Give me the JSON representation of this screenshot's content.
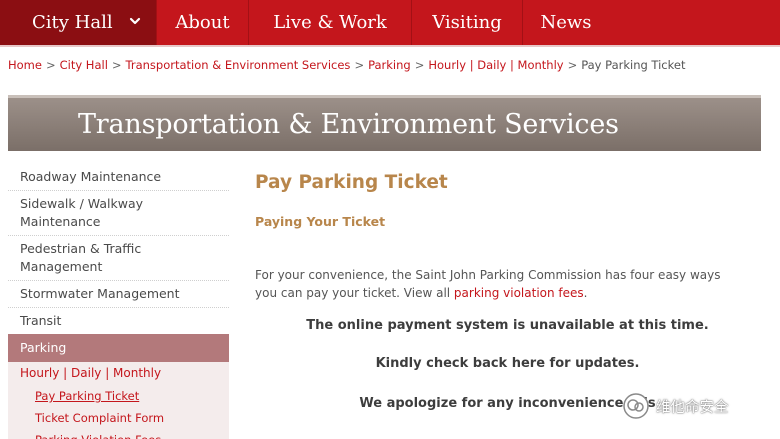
{
  "topnav": {
    "city_hall": "City Hall",
    "about": "About",
    "live_work": "Live & Work",
    "visiting": "Visiting",
    "news": "News"
  },
  "breadcrumb": {
    "home": "Home",
    "city_hall": "City Hall",
    "tes": "Transportation & Environment Services",
    "parking": "Parking",
    "hdm": "Hourly | Daily | Monthly",
    "current": "Pay Parking Ticket",
    "separator": ">"
  },
  "banner": {
    "title": "Transportation & Environment Services"
  },
  "sidebar": {
    "items": [
      "Roadway Maintenance",
      "Sidewalk / Walkway Maintenance",
      "Pedestrian & Traffic Management",
      "Stormwater Management",
      "Transit"
    ],
    "active": "Parking",
    "sub": "Hourly | Daily | Monthly",
    "subsub": [
      "Pay Parking Ticket",
      "Ticket Complaint Form",
      "Parking Violation Fees"
    ]
  },
  "main": {
    "title": "Pay Parking Ticket",
    "subhead": "Paying Your Ticket",
    "intro_text": "For your convenience, the Saint John Parking Commission has four easy ways you can pay your ticket.  View all ",
    "intro_link": "parking violation fees",
    "intro_end": ".",
    "notice1": "The online payment system is unavailable at this time.",
    "notice2": "Kindly check back here for updates.",
    "notice3": "We apologize for any inconvenience this"
  },
  "watermark": {
    "text": "维他命安全"
  },
  "colors": {
    "brand_red": "#c4161c",
    "gold": "#b8864b",
    "banner": "#8b7f78"
  }
}
